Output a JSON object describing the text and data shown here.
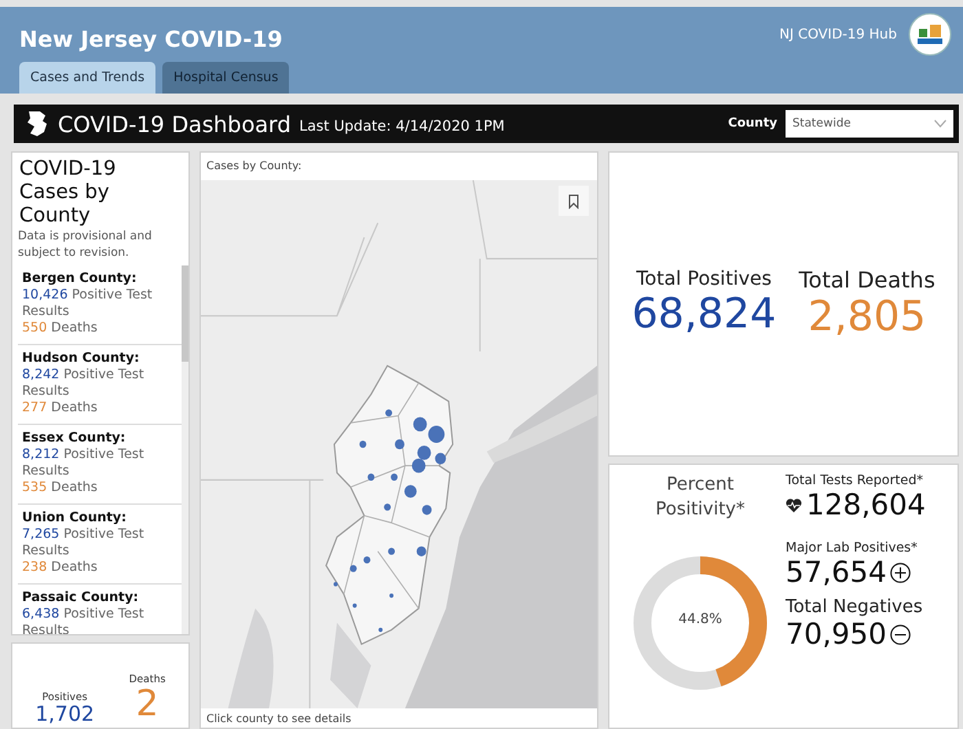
{
  "header": {
    "title": "New Jersey COVID-19",
    "hub_link": "NJ COVID-19 Hub"
  },
  "tabs": [
    {
      "label": "Cases and Trends",
      "selected": true
    },
    {
      "label": "Hospital Census",
      "selected": false
    }
  ],
  "dashboard_bar": {
    "title": "COVID-19 Dashboard",
    "last_update": "Last Update: 4/14/2020 1PM",
    "county_label": "County",
    "county_value": "Statewide"
  },
  "county_panel": {
    "title": "COVID-19 Cases by County",
    "note": "Data is provisional and subject to revision.",
    "counties": [
      {
        "name": "Bergen County:",
        "positives": "10,426",
        "positives_label": "Positive Test Results",
        "deaths": "550",
        "deaths_label": "Deaths"
      },
      {
        "name": "Hudson County:",
        "positives": "8,242",
        "positives_label": "Positive Test Results",
        "deaths": "277",
        "deaths_label": "Deaths"
      },
      {
        "name": "Essex County:",
        "positives": "8,212",
        "positives_label": "Positive Test Results",
        "deaths": "535",
        "deaths_label": "Deaths"
      },
      {
        "name": "Union County:",
        "positives": "7,265",
        "positives_label": "Positive Test Results",
        "deaths": "238",
        "deaths_label": "Deaths"
      },
      {
        "name": "Passaic County:",
        "positives": "6,438",
        "positives_label": "Positive Test Results"
      }
    ]
  },
  "summary_card": {
    "positives_label": "Positives",
    "positives": "1,702",
    "deaths_label": "Deaths",
    "deaths": "2"
  },
  "map": {
    "title": "Cases by County:",
    "footer": "Click county to see details"
  },
  "totals": {
    "positives_label": "Total Positives",
    "positives": "68,824",
    "deaths_label": "Total Deaths",
    "deaths": "2,805"
  },
  "testing": {
    "positivity_label": "Percent Positivity*",
    "positivity": "44.8%",
    "level": 0.448,
    "tests_label": "Total Tests Reported*",
    "tests": "128,604",
    "lab_positives_label": "Major Lab Positives*",
    "lab_positives": "57,654",
    "negatives_label": "Total Negatives",
    "negatives": "70,950"
  }
}
